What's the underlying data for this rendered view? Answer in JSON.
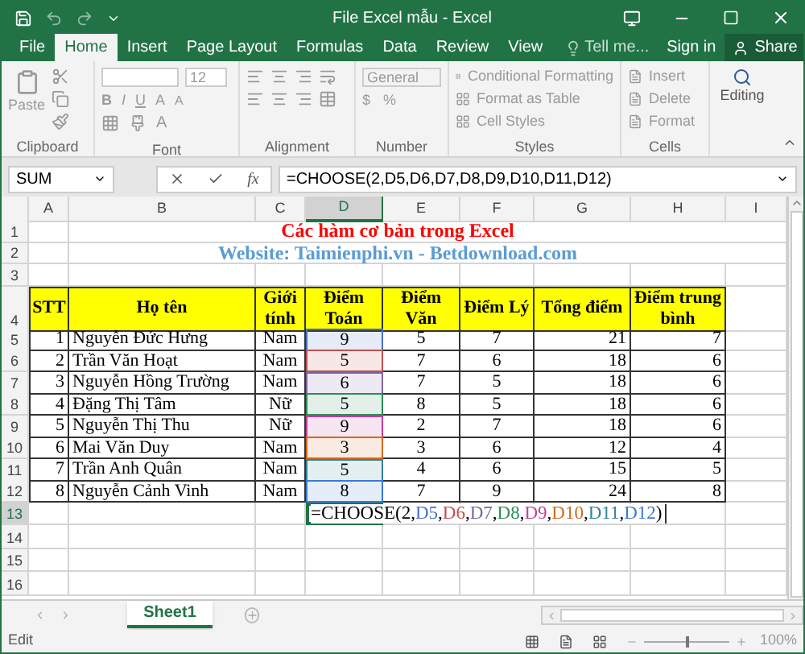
{
  "window": {
    "title": "File Excel mẫu - Excel"
  },
  "tabs": [
    {
      "label": "File",
      "selected": false
    },
    {
      "label": "Home",
      "selected": true
    },
    {
      "label": "Insert",
      "selected": false
    },
    {
      "label": "Page Layout",
      "selected": false
    },
    {
      "label": "Formulas",
      "selected": false
    },
    {
      "label": "Data",
      "selected": false
    },
    {
      "label": "Review",
      "selected": false
    },
    {
      "label": "View",
      "selected": false
    }
  ],
  "tell_me": {
    "placeholder": "Tell me..."
  },
  "sign_in": "Sign in",
  "share": "Share",
  "ribbon": {
    "clipboard": {
      "label": "Clipboard",
      "paste": "Paste"
    },
    "font": {
      "label": "Font",
      "size": "12",
      "buttons": [
        "B",
        "I",
        "U",
        "A",
        "A"
      ],
      "font_color": "A"
    },
    "alignment": {
      "label": "Alignment"
    },
    "number": {
      "label": "Number",
      "format": "General",
      "currency": "$",
      "percent": "%"
    },
    "styles": {
      "label": "Styles",
      "items": [
        "Conditional Formatting",
        "Format as Table",
        "Cell Styles"
      ]
    },
    "cells": {
      "label": "Cells",
      "items": [
        "Insert",
        "Delete",
        "Format"
      ]
    },
    "editing": {
      "label": "Editing"
    }
  },
  "fx": "fx",
  "name_box": "SUM",
  "formula": "=CHOOSE(2,D5,D6,D7,D8,D9,D10,D11,D12)",
  "columns": [
    {
      "label": "A",
      "selected": false
    },
    {
      "label": "B",
      "selected": false
    },
    {
      "label": "C",
      "selected": false
    },
    {
      "label": "D",
      "selected": true
    },
    {
      "label": "E",
      "selected": false
    },
    {
      "label": "F",
      "selected": false
    },
    {
      "label": "G",
      "selected": false
    },
    {
      "label": "H",
      "selected": false
    },
    {
      "label": "I",
      "selected": false
    }
  ],
  "row_numbers": [
    {
      "label": "1",
      "selected": false
    },
    {
      "label": "2",
      "selected": false
    },
    {
      "label": "3",
      "selected": false
    },
    {
      "label": "4",
      "selected": false
    },
    {
      "label": "5",
      "selected": false
    },
    {
      "label": "6",
      "selected": false
    },
    {
      "label": "7",
      "selected": false
    },
    {
      "label": "8",
      "selected": false
    },
    {
      "label": "9",
      "selected": false
    },
    {
      "label": "10",
      "selected": false
    },
    {
      "label": "11",
      "selected": false
    },
    {
      "label": "12",
      "selected": false
    },
    {
      "label": "13",
      "selected": true
    },
    {
      "label": "14",
      "selected": false
    },
    {
      "label": "15",
      "selected": false
    },
    {
      "label": "16",
      "selected": false
    }
  ],
  "sheet_title": "Các hàm cơ bản trong Excel",
  "website": "Website: Taimienphi.vn - Betdownload.com",
  "table": {
    "columns": [
      "STT",
      "Họ tên",
      "Giới tính",
      "Điểm Toán",
      "Điểm Văn",
      "Điểm Lý",
      "Tổng điểm",
      "Điểm trung bình"
    ],
    "rows": [
      {
        "cells": [
          "1",
          "Nguyễn Đức Hưng",
          "Nam",
          "9",
          "5",
          "7",
          "21",
          "7"
        ],
        "color": "#4472c4"
      },
      {
        "cells": [
          "2",
          "Trần Văn Hoạt",
          "Nam",
          "5",
          "7",
          "6",
          "18",
          "6"
        ],
        "color": "#c0504d"
      },
      {
        "cells": [
          "3",
          "Nguyễn Hồng Trường",
          "Nam",
          "6",
          "7",
          "5",
          "18",
          "6"
        ],
        "color": "#8064a2"
      },
      {
        "cells": [
          "4",
          "Đặng Thị Tâm",
          "Nữ",
          "5",
          "8",
          "5",
          "18",
          "6"
        ],
        "color": "#2e8b57"
      },
      {
        "cells": [
          "5",
          "Nguyễn Thị Thu",
          "Nữ",
          "9",
          "2",
          "7",
          "18",
          "6"
        ],
        "color": "#c0409a"
      },
      {
        "cells": [
          "6",
          "Mai Văn Duy",
          "Nam",
          "3",
          "3",
          "6",
          "12",
          "4"
        ],
        "color": "#d2691e"
      },
      {
        "cells": [
          "7",
          "Trần Anh Quân",
          "Nam",
          "5",
          "4",
          "6",
          "15",
          "5"
        ],
        "color": "#31849b"
      },
      {
        "cells": [
          "8",
          "Nguyễn Cảnh Vinh",
          "Nam",
          "8",
          "7",
          "9",
          "24",
          "8"
        ],
        "color": "#3c78d8"
      }
    ]
  },
  "formula_cell": [
    {
      "text": "=CHOOSE(2,",
      "color": "#000000"
    },
    {
      "text": "D5",
      "color": "#4472c4"
    },
    {
      "text": ",",
      "color": "#000000"
    },
    {
      "text": "D6",
      "color": "#c0504d"
    },
    {
      "text": ",",
      "color": "#000000"
    },
    {
      "text": "D7",
      "color": "#8064a2"
    },
    {
      "text": ",",
      "color": "#000000"
    },
    {
      "text": "D8",
      "color": "#2e8b57"
    },
    {
      "text": ",",
      "color": "#000000"
    },
    {
      "text": "D9",
      "color": "#c0409a"
    },
    {
      "text": ",",
      "color": "#000000"
    },
    {
      "text": "D10",
      "color": "#d2691e"
    },
    {
      "text": ",",
      "color": "#000000"
    },
    {
      "text": "D11",
      "color": "#31849b"
    },
    {
      "text": ",",
      "color": "#000000"
    },
    {
      "text": "D12",
      "color": "#3c78d8"
    },
    {
      "text": ")",
      "color": "#000000"
    }
  ],
  "sheets": [
    {
      "label": "Sheet1",
      "selected": true
    }
  ],
  "status": "Edit",
  "zoom_slider": {
    "level": 0.5
  },
  "zoom": "100%"
}
